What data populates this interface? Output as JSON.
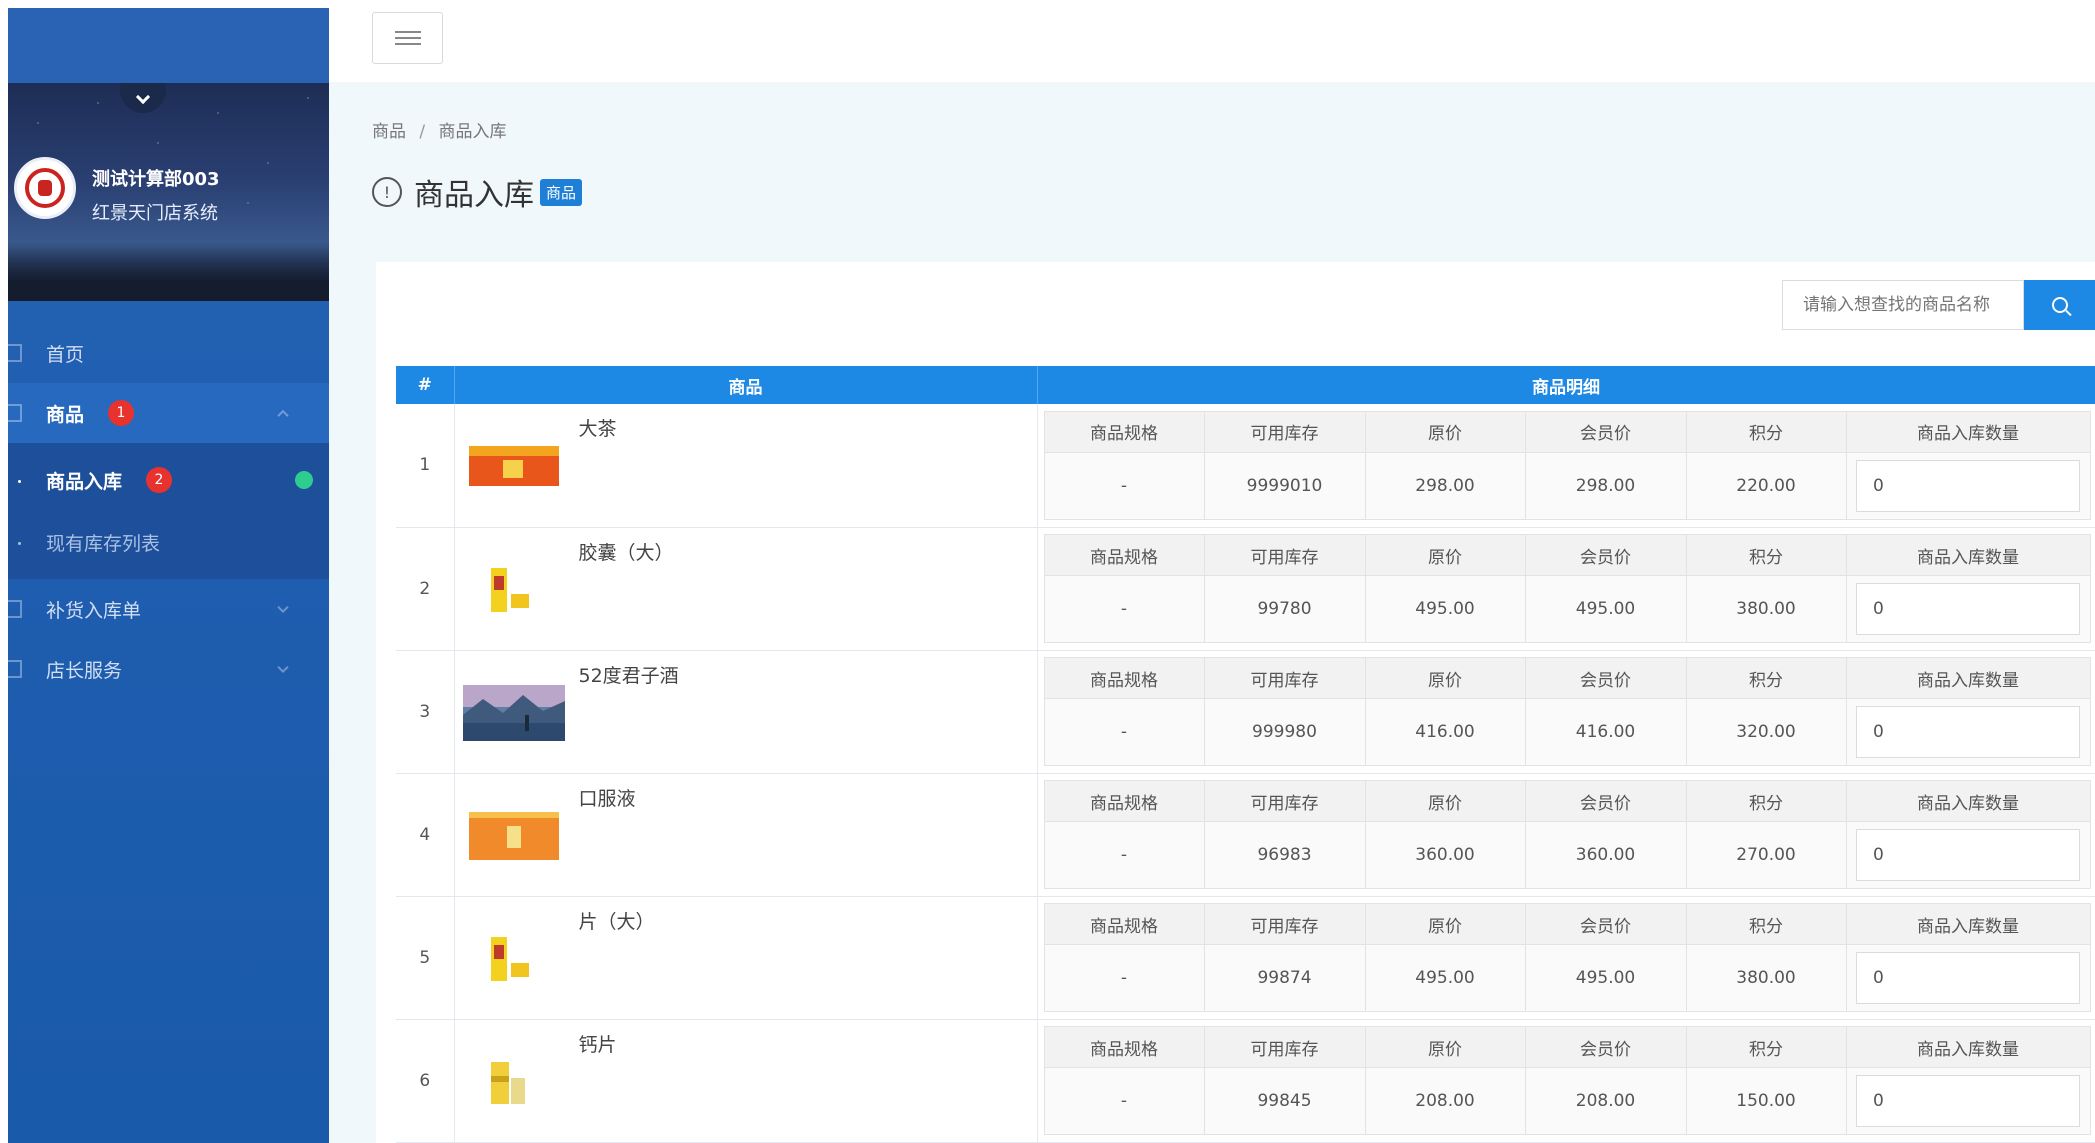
{
  "sidebar": {
    "user_name": "测试计算部003",
    "store_name": "红景天门店系统",
    "nav": {
      "home": "首页",
      "goods": "商品",
      "goods_badge": "1",
      "sub": [
        {
          "label": "商品入库",
          "badge": "2"
        },
        {
          "label": "现有库存列表"
        }
      ],
      "restock": "补货入库单",
      "manager_service": "店长服务"
    }
  },
  "breadcrumb": {
    "root": "商品",
    "sep": "/",
    "current": "商品入库"
  },
  "page": {
    "title": "商品入库",
    "tag": "商品",
    "info_glyph": "!"
  },
  "search": {
    "placeholder": "请输入想查找的商品名称"
  },
  "table": {
    "headers": {
      "index": "#",
      "product": "商品",
      "detail": "商品明细"
    },
    "detail_headers": [
      "商品规格",
      "可用库存",
      "原价",
      "会员价",
      "积分",
      "商品入库数量"
    ],
    "rows": [
      {
        "index": "1",
        "name": "大茶",
        "spec": "-",
        "stock": "9999010",
        "price": "298.00",
        "member_price": "298.00",
        "points": "220.00",
        "qty": "0",
        "thumb": "box-red"
      },
      {
        "index": "2",
        "name": "胶囊（大）",
        "spec": "-",
        "stock": "99780",
        "price": "495.00",
        "member_price": "495.00",
        "points": "380.00",
        "qty": "0",
        "thumb": "bottle-yellow"
      },
      {
        "index": "3",
        "name": "52度君子酒",
        "spec": "-",
        "stock": "999980",
        "price": "416.00",
        "member_price": "416.00",
        "points": "320.00",
        "qty": "0",
        "thumb": "landscape"
      },
      {
        "index": "4",
        "name": "口服液",
        "spec": "-",
        "stock": "96983",
        "price": "360.00",
        "member_price": "360.00",
        "points": "270.00",
        "qty": "0",
        "thumb": "box-orange"
      },
      {
        "index": "5",
        "name": "片（大）",
        "spec": "-",
        "stock": "99874",
        "price": "495.00",
        "member_price": "495.00",
        "points": "380.00",
        "qty": "0",
        "thumb": "bottle-yellow"
      },
      {
        "index": "6",
        "name": "钙片",
        "spec": "-",
        "stock": "99845",
        "price": "208.00",
        "member_price": "208.00",
        "points": "150.00",
        "qty": "0",
        "thumb": "jar-yellow"
      }
    ]
  },
  "colors": {
    "sidebar": "#1f5eb0",
    "accent": "#1e88e5",
    "badge": "#e8322d",
    "status_dot": "#2ecc8f"
  }
}
